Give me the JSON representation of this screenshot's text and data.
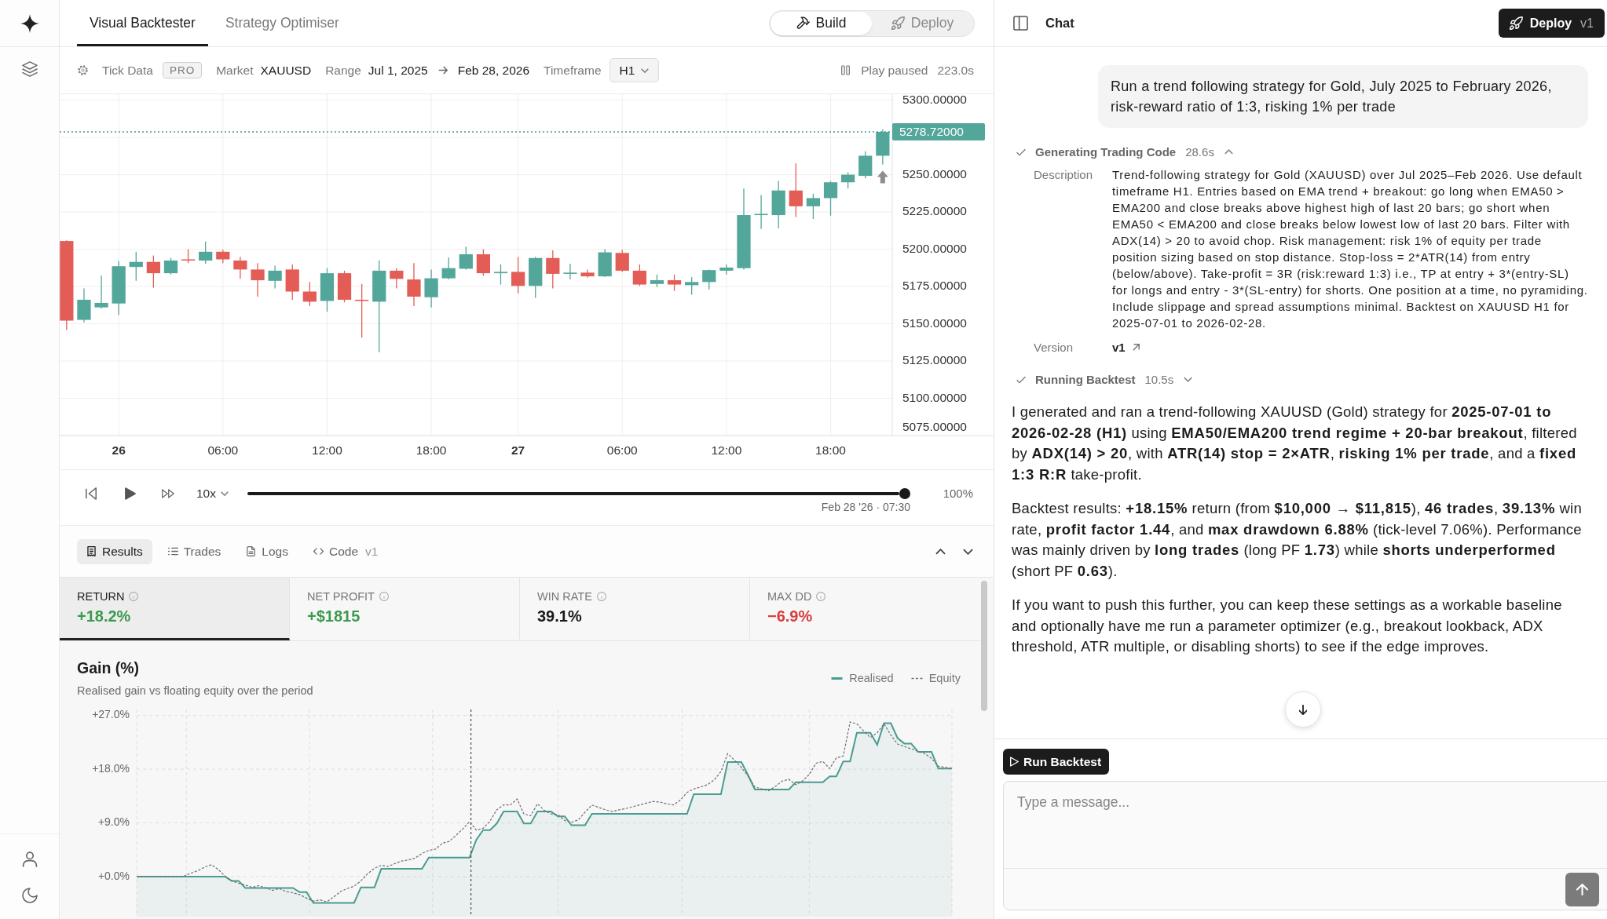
{
  "main_tabs": [
    {
      "label": "Visual Backtester",
      "selected": true
    },
    {
      "label": "Strategy Optimiser",
      "selected": false
    }
  ],
  "mode_switch": [
    {
      "label": "Build",
      "kind": "build",
      "selected": true
    },
    {
      "label": "Deploy",
      "kind": "deploy",
      "selected": false
    }
  ],
  "toolbar": {
    "data_source": "Tick Data",
    "data_tag": "PRO",
    "market_label": "Market",
    "market": "XAUUSD",
    "range_label": "Range",
    "range_start": "Jul 1, 2025",
    "range_end": "Feb 28, 2026",
    "timeframe_label": "Timeframe",
    "timeframe": "H1",
    "play_status": "Play paused",
    "elapsed": "223.0s"
  },
  "price_chart": {
    "price_labels": [
      "5300.00000",
      "5250.00000",
      "5225.00000",
      "5200.00000",
      "5175.00000",
      "5150.00000",
      "5125.00000",
      "5100.00000",
      "5075.00000"
    ],
    "time_labels": [
      {
        "label": "26",
        "kind": "day"
      },
      {
        "label": "06:00",
        "kind": "hour"
      },
      {
        "label": "12:00",
        "kind": "hour"
      },
      {
        "label": "18:00",
        "kind": "hour"
      },
      {
        "label": "27",
        "kind": "day"
      },
      {
        "label": "06:00",
        "kind": "hour"
      },
      {
        "label": "12:00",
        "kind": "hour"
      },
      {
        "label": "18:00",
        "kind": "hour"
      }
    ],
    "last_price": "5278.72000"
  },
  "playback": {
    "speed": "10x",
    "level": 1,
    "position_label": "Feb 28 '26 · 07:30",
    "percent": "100%"
  },
  "result_tabs": [
    {
      "label": "Results",
      "kind": "results",
      "selected": true
    },
    {
      "label": "Trades",
      "kind": "trades",
      "selected": false
    },
    {
      "label": "Logs",
      "kind": "logs",
      "selected": false
    },
    {
      "label": "Code",
      "kind": "code",
      "badge": "v1",
      "selected": false
    }
  ],
  "metrics": [
    {
      "label": "RETURN",
      "value": "+18.2%",
      "color": "#3c9a4e",
      "selected": true
    },
    {
      "label": "NET PROFIT",
      "value": "+$1815",
      "color": "#3c9a4e",
      "selected": false
    },
    {
      "label": "WIN RATE",
      "value": "39.1%",
      "color": "#1a1a1a",
      "selected": false
    },
    {
      "label": "MAX DD",
      "value": "−6.9%",
      "color": "#d83c3c",
      "selected": false
    }
  ],
  "gain_chart": {
    "title": "Gain (%)",
    "subtitle": "Realised gain vs floating equity over the period",
    "chart_data": {
      "type": "line",
      "grid": true,
      "ylim": [
        -6.7,
        28
      ],
      "yticks": [
        {
          "value": 27,
          "label": "+27.0%"
        },
        {
          "value": 18,
          "label": "+18.0%"
        },
        {
          "value": 9,
          "label": "+9.0%"
        },
        {
          "value": 0,
          "label": "+0.0%"
        }
      ],
      "categories": [
        null,
        null,
        null,
        null,
        null,
        null,
        null,
        null,
        null,
        null,
        null,
        null,
        null,
        null,
        null,
        null,
        null,
        null,
        null,
        null,
        null,
        null,
        null,
        null,
        null,
        null,
        null,
        null,
        null,
        null,
        null,
        null,
        null,
        null,
        null,
        null,
        null,
        null,
        null,
        null,
        null,
        null,
        null,
        null,
        null,
        null,
        null,
        null,
        null,
        null,
        null,
        null,
        null,
        null,
        null,
        null,
        null,
        null,
        null,
        null,
        null,
        null,
        null,
        null,
        null,
        null,
        null,
        null,
        null,
        null,
        null,
        null,
        null,
        null,
        null,
        null,
        null,
        null,
        null,
        null,
        null,
        null,
        null,
        null,
        null,
        null,
        null,
        null,
        null,
        null,
        null,
        null,
        null,
        null,
        null,
        null,
        null,
        null,
        null,
        null,
        null,
        null,
        null,
        null,
        null,
        null,
        null,
        null,
        null,
        null,
        null,
        null,
        null,
        null,
        null,
        null,
        null,
        null,
        null,
        null,
        null
      ],
      "series": [
        {
          "name": "Realised",
          "color": "#4a9d92",
          "line_style": "solid",
          "values": [
            0,
            0,
            0,
            0,
            0,
            0,
            0,
            0,
            0,
            0,
            0,
            0,
            0,
            0,
            -0.7,
            -0.7,
            -1.9,
            -1.9,
            -1.9,
            -1.9,
            -1.9,
            -1.9,
            -1.9,
            -1.9,
            -2.6,
            -2.6,
            -4.4,
            -4.4,
            -4.4,
            -4.4,
            -4.4,
            -4.4,
            -4.4,
            -1.8,
            -1.8,
            -1.8,
            1.3,
            1.3,
            1.3,
            1.3,
            1.3,
            1.3,
            1.3,
            3.2,
            3.2,
            3.2,
            3.2,
            3.2,
            3.2,
            3.2,
            6.2,
            7.8,
            7.8,
            8.9,
            10.9,
            10.9,
            10.9,
            8.9,
            8.9,
            10.9,
            10.9,
            10.9,
            10.1,
            10.1,
            8.6,
            8.6,
            8.6,
            10.5,
            10.5,
            10.5,
            10.5,
            10.5,
            10.5,
            10.5,
            10.5,
            10.5,
            10.5,
            10.5,
            10.5,
            10.5,
            10.5,
            10.5,
            13.8,
            13.8,
            13.8,
            13.8,
            13.8,
            19.2,
            19.2,
            19.2,
            17.0,
            14.6,
            14.6,
            14.6,
            14.6,
            14.6,
            14.6,
            15.8,
            15.8,
            15.8,
            15.8,
            15.8,
            16.8,
            16.8,
            19.3,
            19.3,
            24.1,
            24.1,
            24.1,
            22.1,
            25.7,
            25.7,
            23.2,
            22.3,
            22.3,
            20.9,
            20.9,
            20.9,
            18.1,
            18.1,
            18.1
          ]
        },
        {
          "name": "Equity",
          "color": "#6f6f6f",
          "line_style": "dashed",
          "values": [
            0,
            0,
            0,
            0,
            0,
            0,
            0,
            0.1,
            0.6,
            1.0,
            1.6,
            2.0,
            1.2,
            0.1,
            -0.7,
            -1.1,
            -1.4,
            -1.8,
            -1.5,
            -1.9,
            -2.3,
            -2.0,
            -2.5,
            -2.7,
            -3.0,
            -3.6,
            -4.1,
            -3.9,
            -4.2,
            -3.4,
            -2.5,
            -2.0,
            -1.6,
            -0.7,
            0.5,
            1.4,
            1.9,
            1.7,
            2.2,
            2.6,
            2.8,
            3.1,
            3.9,
            4.4,
            4.6,
            5.6,
            5.9,
            6.9,
            8.0,
            9.2,
            7.8,
            8.1,
            9.3,
            11.2,
            12.0,
            12.0,
            13.0,
            10.5,
            10.2,
            12.2,
            11.1,
            10.5,
            10.4,
            9.4,
            9.1,
            9.5,
            10.8,
            12.0,
            11.6,
            11.2,
            10.9,
            11.2,
            11.4,
            11.7,
            12.0,
            12.3,
            12.6,
            12.5,
            12.2,
            12.0,
            12.8,
            14.1,
            14.7,
            15.0,
            15.4,
            16.2,
            17.6,
            20.6,
            19.5,
            18.3,
            16.8,
            15.0,
            14.7,
            14.4,
            15.1,
            16.0,
            16.3,
            15.4,
            16.0,
            17.1,
            19.0,
            19.3,
            18.1,
            19.9,
            20.2,
            25.9,
            25.6,
            24.4,
            23.3,
            24.1,
            25.6,
            23.7,
            22.2,
            21.8,
            21.4,
            21.0,
            20.6,
            19.8,
            18.5,
            18.3,
            18.1
          ]
        }
      ]
    }
  },
  "chat": {
    "title": "Chat",
    "deploy_button": {
      "label": "Deploy",
      "version": "v1"
    },
    "user_message": "Run a trend following strategy for Gold, July 2025 to February 2026, risk-reward ratio of 1:3, risking 1% per trade",
    "steps": [
      {
        "label": "Generating Trading Code",
        "duration": "28.6s",
        "done": true,
        "expanded": true,
        "details": [
          {
            "label": "Description",
            "value": "Trend-following strategy for Gold (XAUUSD) over Jul 2025–Feb 2026. Use default timeframe H1. Entries based on EMA trend + breakout: go long when EMA50 > EMA200 and close breaks above highest high of last 20 bars; go short when EMA50 < EMA200 and close breaks below lowest low of last 20 bars. Filter with ADX(14) > 20 to avoid chop. Risk management: risk 1% of equity per trade position sizing based on stop distance. Stop-loss = 2*ATR(14) from entry (below/above). Take-profit = 3R (risk:reward 1:3) i.e., TP at entry + 3*(entry-SL) for longs and entry - 3*(SL-entry) for shorts. One position at a time, no pyramiding. Include slippage and spread assumptions minimal. Backtest on XAUUSD H1 for 2025-07-01 to 2026-02-28.",
            "kind": "text"
          },
          {
            "label": "Version",
            "value": "v1",
            "kind": "link"
          }
        ]
      },
      {
        "label": "Running Backtest",
        "duration": "10.5s",
        "done": true,
        "expanded": false
      }
    ],
    "reply": [
      "I generated and ran a trend-following XAUUSD (Gold) strategy for **2025-07-01 to 2026-02-28 (H1)** using **EMA50/EMA200 trend regime + 20-bar breakout**, filtered by **ADX(14) > 20**, with **ATR(14) stop = 2×ATR**, **risking 1% per trade**, and a **fixed 1:3 R:R** take-profit.",
      "Backtest results: **+18.15%** return (from **$10,000 → $11,815**), **46 trades**, **39.13%** win rate, **profit factor 1.44**, and **max drawdown 6.88%** (tick-level 7.06%). Performance was mainly driven by **long trades** (long PF **1.73**) while **shorts underperformed** (short PF **0.63**).",
      "If you want to push this further, you can keep these settings as a workable baseline and optionally have me run a parameter optimizer (e.g., breakout lookback, ADX threshold, ATR multiple, or disabling shorts) to see if the edge improves."
    ],
    "run_button": "Run Backtest",
    "input": {
      "placeholder": "Type a message..."
    },
    "send_button": {
      "disabled": true
    }
  }
}
